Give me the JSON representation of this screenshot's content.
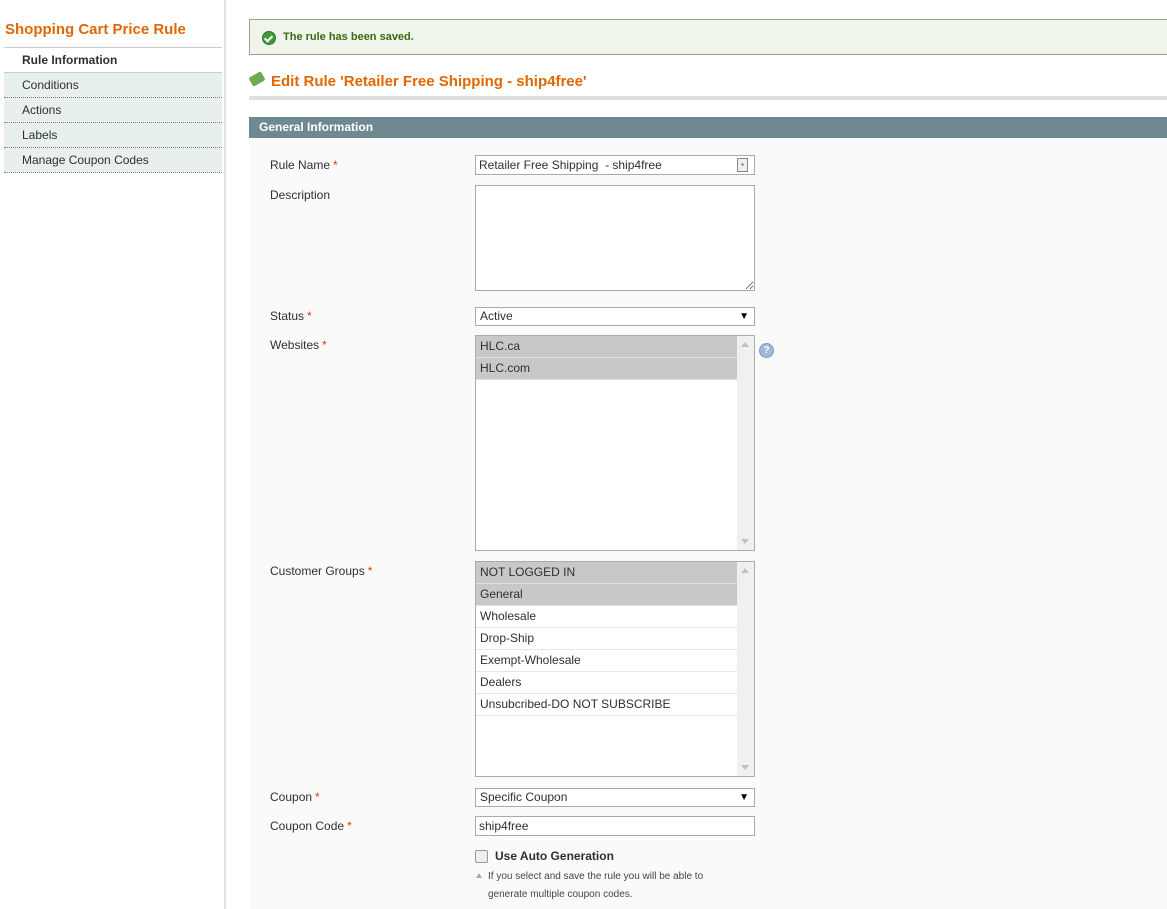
{
  "sidebar": {
    "title": "Shopping Cart Price Rule",
    "tabs": [
      {
        "label": "Rule Information",
        "active": true
      },
      {
        "label": "Conditions",
        "active": false
      },
      {
        "label": "Actions",
        "active": false
      },
      {
        "label": "Labels",
        "active": false
      },
      {
        "label": "Manage Coupon Codes",
        "active": false
      }
    ]
  },
  "message": {
    "text": "The rule has been saved.",
    "icon": "success-check-icon"
  },
  "page": {
    "title": "Edit Rule 'Retailer Free Shipping - ship4free'"
  },
  "section": {
    "title": "General Information"
  },
  "form": {
    "required_marker": "*",
    "rule_name": {
      "label": "Rule Name",
      "value": "Retailer Free Shipping  - ship4free"
    },
    "description": {
      "label": "Description",
      "value": ""
    },
    "status": {
      "label": "Status",
      "value": "Active"
    },
    "websites": {
      "label": "Websites",
      "options": [
        {
          "label": "HLC.ca",
          "selected": true
        },
        {
          "label": "HLC.com",
          "selected": true
        }
      ]
    },
    "customer_groups": {
      "label": "Customer Groups",
      "options": [
        {
          "label": "NOT LOGGED IN",
          "selected": true
        },
        {
          "label": "General",
          "selected": true
        },
        {
          "label": "Wholesale",
          "selected": false
        },
        {
          "label": "Drop-Ship",
          "selected": false
        },
        {
          "label": "Exempt-Wholesale",
          "selected": false
        },
        {
          "label": "Dealers",
          "selected": false
        },
        {
          "label": "Unsubcribed-DO NOT SUBSCRIBE",
          "selected": false
        }
      ]
    },
    "coupon": {
      "label": "Coupon",
      "value": "Specific Coupon"
    },
    "coupon_code": {
      "label": "Coupon Code",
      "value": "ship4free"
    },
    "auto_generation": {
      "label": "Use Auto Generation",
      "checked": false,
      "note_line1": "If you select and save the rule you will be able to",
      "note_line2": "generate multiple coupon codes."
    }
  },
  "icons": {
    "help": "?",
    "dropdown": "▼"
  }
}
